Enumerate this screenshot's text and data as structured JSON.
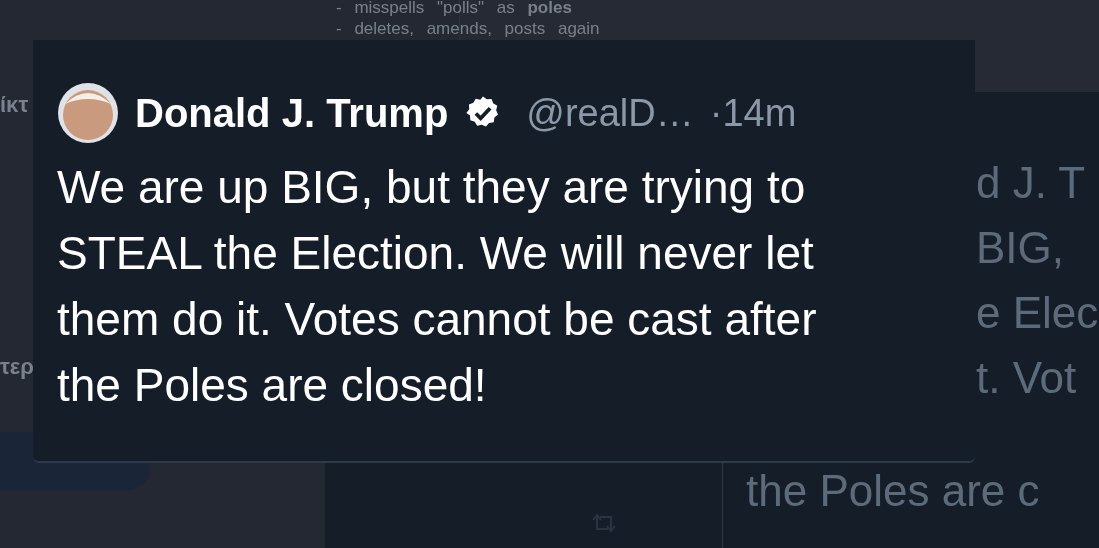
{
  "background_notes": [
    "- misspells \"polls\" as **poles**",
    "- deletes, amends, posts again"
  ],
  "side_fragments": [
    "ίκτ",
    "τερ"
  ],
  "background_tweet": {
    "side_lines": [
      "d J. T",
      "BIG,",
      "e Elec",
      "t. Vot"
    ],
    "bottom_line": "the Poles are c"
  },
  "tweet": {
    "author": "Donald J. Trump",
    "verified": true,
    "handle": "@realD…",
    "time": "·14m",
    "text": "We are up BIG, but they are trying to STEAL the Election. We will never let them do it. Votes cannot be cast after the Poles are closed!"
  }
}
